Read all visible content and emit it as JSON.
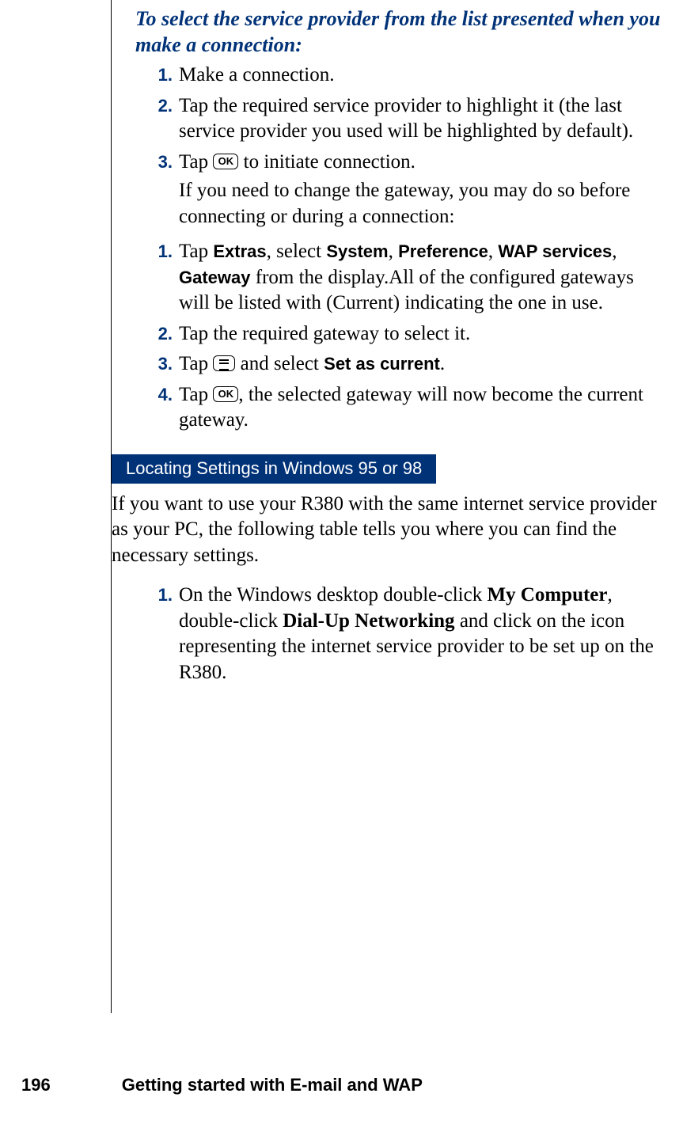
{
  "intro_heading": "To select the service provider from the list presented when you make a connection:",
  "list_a": {
    "1": {
      "num": "1.",
      "text": "Make a connection."
    },
    "2": {
      "num": "2.",
      "text": "Tap the required service provider to highlight it (the last service provider you used will be highlighted by default)."
    },
    "3": {
      "num": "3.",
      "preText": "Tap ",
      "postText": " to initiate connection.",
      "subText": "If you need to change the gateway, you may do so before connecting or during a connection:"
    }
  },
  "icons": {
    "ok": "OK"
  },
  "list_b": {
    "1": {
      "num": "1.",
      "parts": {
        "p1": "Tap ",
        "extras": "Extras",
        "p2": ", select ",
        "system": "System",
        "p3": ", ",
        "preference": "Preference",
        "p4": ", ",
        "wap": "WAP services",
        "p5": ", ",
        "gateway": "Gateway",
        "p6": " from the display.All of the configured gateways will be listed with (Current) indicating the one in use."
      }
    },
    "2": {
      "num": "2.",
      "text": "Tap the required gateway to select it."
    },
    "3": {
      "num": "3.",
      "preText": "Tap ",
      "midText": " and select ",
      "setCurrent": "Set as current",
      "postText": "."
    },
    "4": {
      "num": "4.",
      "preText": "Tap ",
      "postText": ", the selected gateway will now become the current gateway."
    }
  },
  "section_heading": "Locating Settings in Windows 95 or 98",
  "section_para": "If you want to use your R380 with the same internet service provider as your PC, the following table tells you where you can find the necessary settings.",
  "list_c": {
    "1": {
      "num": "1.",
      "p1": "On the Windows desktop double-click ",
      "mycomputer": "My Computer",
      "p2": ", double-click ",
      "dialup": "Dial-Up Networking",
      "p3": " and click on the icon representing the internet service provider to be set up on the R380."
    }
  },
  "footer": {
    "page_number": "196",
    "title": "Getting started with E-mail and WAP"
  }
}
